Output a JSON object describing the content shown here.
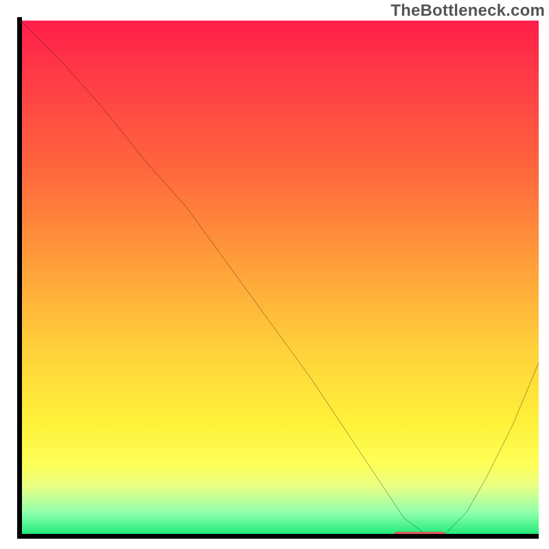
{
  "watermark": "TheBottleneck.com",
  "colors": {
    "axis": "#000000",
    "curve": "#000000",
    "marker": "#e05a5a"
  },
  "chart_data": {
    "type": "line",
    "title": "",
    "xlabel": "",
    "ylabel": "",
    "xlim": [
      0,
      100
    ],
    "ylim": [
      0,
      100
    ],
    "grid": false,
    "legend": false,
    "series": [
      {
        "name": "bottleneck-curve",
        "x": [
          0,
          8,
          16,
          24,
          32,
          40,
          48,
          56,
          64,
          70,
          74,
          78,
          82,
          86,
          90,
          95,
          100
        ],
        "y": [
          100,
          92,
          83,
          73,
          64,
          53,
          42,
          31,
          19,
          10,
          4,
          1,
          1,
          5,
          12,
          22,
          34
        ]
      }
    ],
    "annotations": [
      {
        "name": "min-marker",
        "x_start": 72,
        "x_end": 82,
        "y": 0.8
      }
    ],
    "background_gradient": {
      "direction": "vertical",
      "stops": [
        {
          "pos": 0.0,
          "color": "#ff1e49"
        },
        {
          "pos": 0.12,
          "color": "#ff3e46"
        },
        {
          "pos": 0.3,
          "color": "#ff6a3c"
        },
        {
          "pos": 0.48,
          "color": "#ffa23a"
        },
        {
          "pos": 0.64,
          "color": "#ffd23a"
        },
        {
          "pos": 0.78,
          "color": "#fff23a"
        },
        {
          "pos": 0.86,
          "color": "#fdff5a"
        },
        {
          "pos": 0.9,
          "color": "#e8ff86"
        },
        {
          "pos": 0.95,
          "color": "#8fffad"
        },
        {
          "pos": 1.0,
          "color": "#09e86e"
        }
      ]
    }
  }
}
